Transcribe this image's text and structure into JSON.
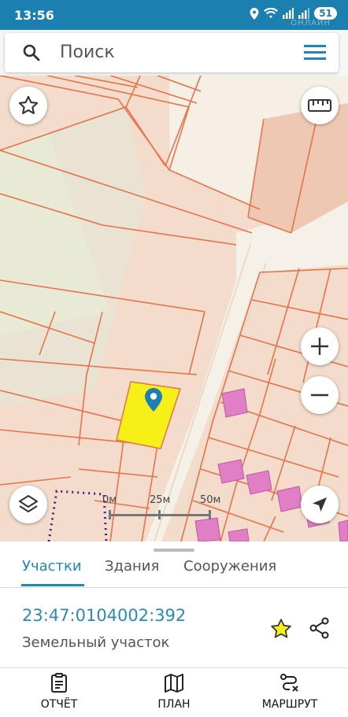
{
  "status_bar": {
    "time": "13:56",
    "battery": "51",
    "watermark": "ОНЛАЙН"
  },
  "search": {
    "placeholder": "Поиск"
  },
  "map": {
    "colors": {
      "land": "#f3dccb",
      "boundary": "#e8734a",
      "selected": "#f7ef18",
      "building": "#e07ec6",
      "road": "#f4f0e6",
      "green": "#e8ead8"
    },
    "scale": {
      "labels": [
        "0м",
        "25м",
        "50м"
      ]
    }
  },
  "sheet": {
    "tabs": [
      {
        "label": "Участки",
        "active": true
      },
      {
        "label": "Здания",
        "active": false
      },
      {
        "label": "Сооружения",
        "active": false
      }
    ],
    "cadastral_number": "23:47:0104002:392",
    "object_type": "Земельный участок"
  },
  "bottom_nav": {
    "items": [
      {
        "label": "ОТЧЁТ",
        "icon": "report-icon"
      },
      {
        "label": "ПЛАН",
        "icon": "map-plan-icon"
      },
      {
        "label": "МАРШРУТ",
        "icon": "route-icon"
      }
    ]
  }
}
